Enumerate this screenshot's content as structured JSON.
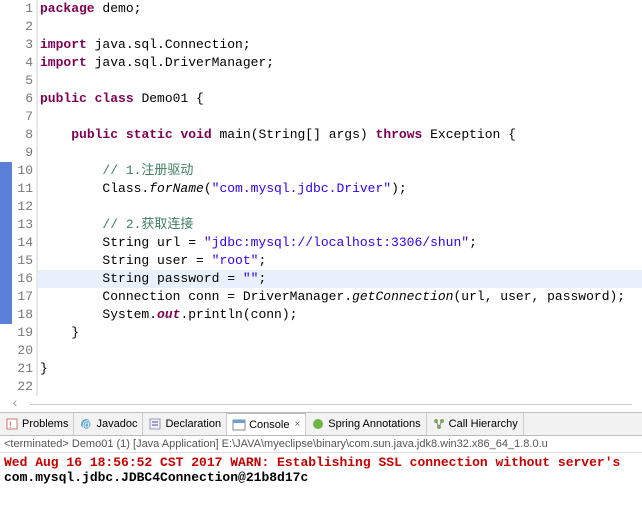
{
  "editor": {
    "lines": [
      {
        "n": "1",
        "marker": "",
        "tokens": [
          {
            "c": "kw",
            "t": "package"
          },
          {
            "c": "norm",
            "t": " demo;"
          }
        ]
      },
      {
        "n": "2",
        "marker": "",
        "tokens": []
      },
      {
        "n": "3",
        "marker": "",
        "tokens": [
          {
            "c": "kw",
            "t": "import"
          },
          {
            "c": "norm",
            "t": " java.sql.Connection;"
          }
        ]
      },
      {
        "n": "4",
        "marker": "",
        "tokens": [
          {
            "c": "kw",
            "t": "import"
          },
          {
            "c": "norm",
            "t": " java.sql.DriverManager;"
          }
        ]
      },
      {
        "n": "5",
        "marker": "",
        "tokens": []
      },
      {
        "n": "6",
        "marker": "",
        "tokens": [
          {
            "c": "kw",
            "t": "public"
          },
          {
            "c": "norm",
            "t": " "
          },
          {
            "c": "kw",
            "t": "class"
          },
          {
            "c": "norm",
            "t": " Demo01 {"
          }
        ]
      },
      {
        "n": "7",
        "marker": "",
        "tokens": []
      },
      {
        "n": "8",
        "marker": "",
        "tokens": [
          {
            "c": "norm",
            "t": "    "
          },
          {
            "c": "kw",
            "t": "public"
          },
          {
            "c": "norm",
            "t": " "
          },
          {
            "c": "kw",
            "t": "static"
          },
          {
            "c": "norm",
            "t": " "
          },
          {
            "c": "kw",
            "t": "void"
          },
          {
            "c": "norm",
            "t": " main(String[] args) "
          },
          {
            "c": "kw",
            "t": "throws"
          },
          {
            "c": "norm",
            "t": " Exception {"
          }
        ]
      },
      {
        "n": "9",
        "marker": "",
        "tokens": []
      },
      {
        "n": "10",
        "marker": "blue",
        "tokens": [
          {
            "c": "norm",
            "t": "        "
          },
          {
            "c": "com",
            "t": "// 1.注册驱动"
          }
        ]
      },
      {
        "n": "11",
        "marker": "blue",
        "tokens": [
          {
            "c": "norm",
            "t": "        Class."
          },
          {
            "c": "it",
            "t": "forName"
          },
          {
            "c": "norm",
            "t": "("
          },
          {
            "c": "str",
            "t": "\"com.mysql.jdbc.Driver\""
          },
          {
            "c": "norm",
            "t": ");"
          }
        ]
      },
      {
        "n": "12",
        "marker": "blue",
        "tokens": []
      },
      {
        "n": "13",
        "marker": "blue",
        "tokens": [
          {
            "c": "norm",
            "t": "        "
          },
          {
            "c": "com",
            "t": "// 2.获取连接"
          }
        ]
      },
      {
        "n": "14",
        "marker": "blue",
        "tokens": [
          {
            "c": "norm",
            "t": "        String url = "
          },
          {
            "c": "str",
            "t": "\"jdbc:mysql://localhost:3306/shun\""
          },
          {
            "c": "norm",
            "t": ";"
          }
        ]
      },
      {
        "n": "15",
        "marker": "blue",
        "tokens": [
          {
            "c": "norm",
            "t": "        String user = "
          },
          {
            "c": "str",
            "t": "\"root\""
          },
          {
            "c": "norm",
            "t": ";"
          }
        ]
      },
      {
        "n": "16",
        "marker": "blue",
        "hl": true,
        "tokens": [
          {
            "c": "norm",
            "t": "        String password = "
          },
          {
            "c": "str",
            "t": "\"\""
          },
          {
            "c": "norm",
            "t": ";"
          }
        ]
      },
      {
        "n": "17",
        "marker": "blue",
        "tokens": [
          {
            "c": "norm",
            "t": "        Connection conn = DriverManager."
          },
          {
            "c": "it",
            "t": "getConnection"
          },
          {
            "c": "norm",
            "t": "(url, user, password);"
          }
        ]
      },
      {
        "n": "18",
        "marker": "blue",
        "tokens": [
          {
            "c": "norm",
            "t": "        System."
          },
          {
            "c": "kw it",
            "t": "out"
          },
          {
            "c": "norm",
            "t": ".println(conn);"
          }
        ]
      },
      {
        "n": "19",
        "marker": "",
        "tokens": [
          {
            "c": "norm",
            "t": "    }"
          }
        ]
      },
      {
        "n": "20",
        "marker": "",
        "tokens": []
      },
      {
        "n": "21",
        "marker": "",
        "tokens": [
          {
            "c": "norm",
            "t": "}"
          }
        ]
      },
      {
        "n": "22",
        "marker": "",
        "tokens": []
      }
    ]
  },
  "tabs": {
    "problems": "Problems",
    "javadoc": "Javadoc",
    "declaration": "Declaration",
    "console": "Console",
    "spring": "Spring Annotations",
    "callhier": "Call Hierarchy",
    "close": "×"
  },
  "console": {
    "header": "<terminated> Demo01 (1) [Java Application] E:\\JAVA\\myeclipse\\binary\\com.sun.java.jdk8.win32.x86_64_1.8.0.u",
    "out": [
      {
        "cls": "warn",
        "text": "Wed Aug 16 18:56:52 CST 2017 WARN: Establishing SSL connection without server's "
      },
      {
        "cls": "std",
        "text": "com.mysql.jdbc.JDBC4Connection@21b8d17c"
      }
    ]
  }
}
